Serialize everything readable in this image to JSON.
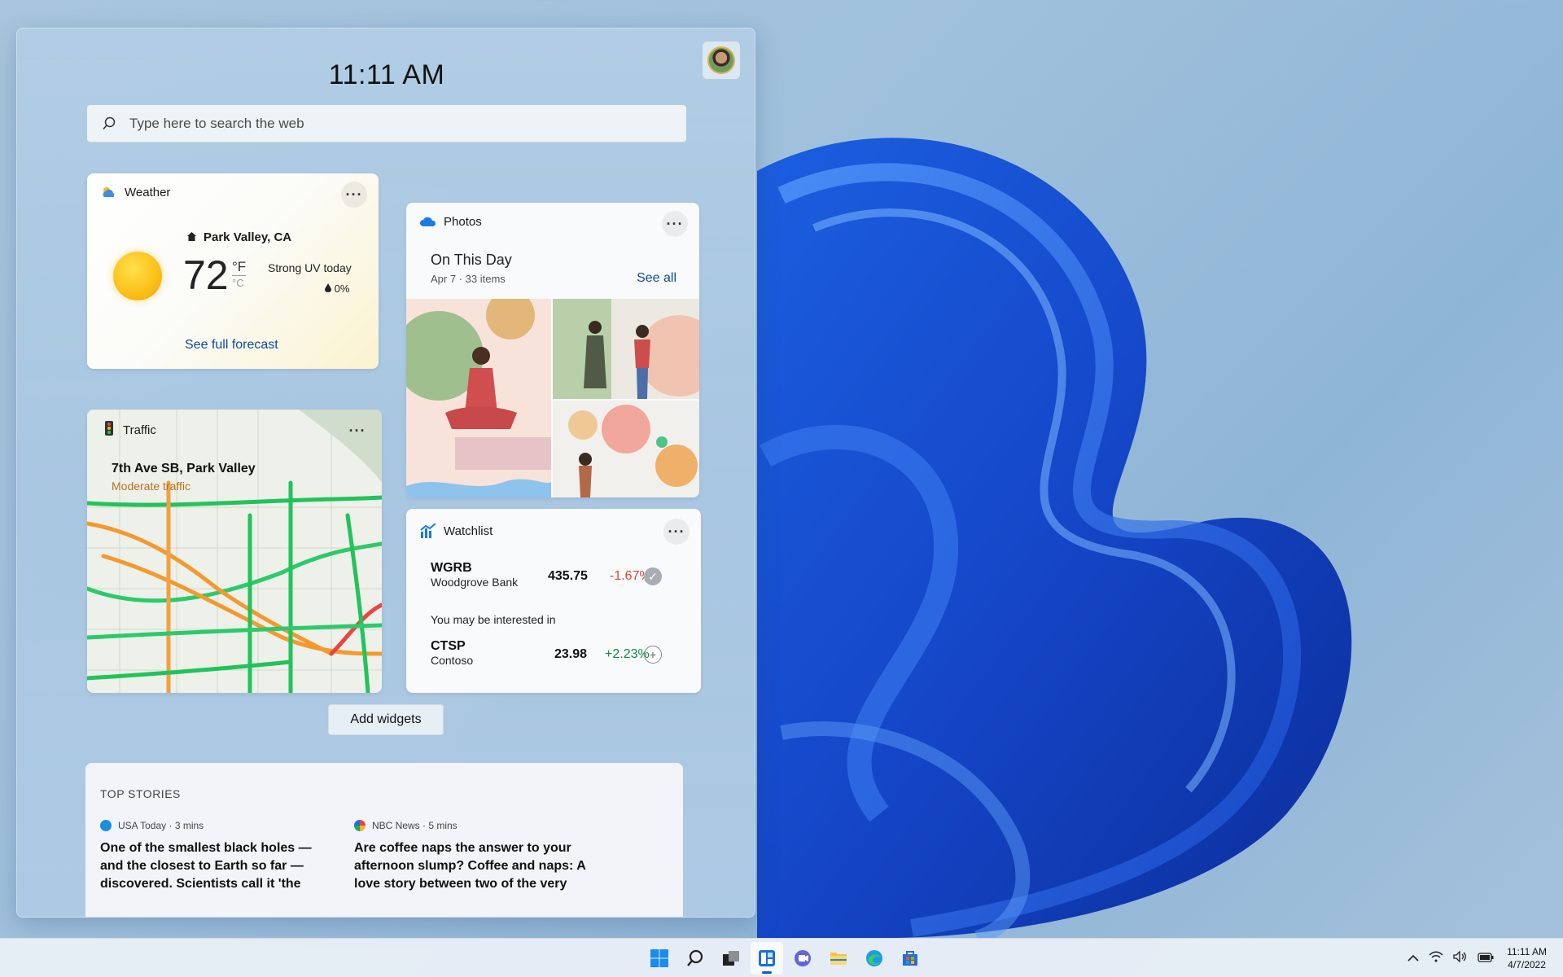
{
  "panel": {
    "time": "11:11 AM",
    "search_placeholder": "Type here to search the web",
    "add_widgets_label": "Add widgets"
  },
  "weather": {
    "title": "Weather",
    "location": "Park Valley, CA",
    "temperature": "72",
    "unit_f": "°F",
    "unit_c": "°C",
    "condition": "Strong UV today",
    "precipitation": "0%",
    "forecast_link": "See full forecast",
    "icon": "sun-icon"
  },
  "traffic": {
    "title": "Traffic",
    "route": "7th Ave SB, Park Valley",
    "status": "Moderate traffic",
    "status_color": "#b5731f"
  },
  "photos": {
    "title": "Photos",
    "album": "On This Day",
    "date": "Apr 7",
    "count": "· 33 items",
    "see_all": "See all"
  },
  "watchlist": {
    "title": "Watchlist",
    "stocks": [
      {
        "symbol": "WGRB",
        "name": "Woodgrove Bank",
        "price": "435.75",
        "change": "-1.67%",
        "color": "#e0442f"
      }
    ],
    "interest_label": "You may be interested in",
    "suggestions": [
      {
        "symbol": "CTSP",
        "name": "Contoso",
        "price": "23.98",
        "change": "+2.23%",
        "color": "#0f8a3c"
      }
    ]
  },
  "top_stories": {
    "heading": "TOP STORIES",
    "stories": [
      {
        "source": "USA Today · 3 mins",
        "title": "One of the smallest black holes — and the closest to Earth so far — discovered. Scientists call it 'the"
      },
      {
        "source": "NBC News · 5 mins",
        "title": "Are coffee naps the answer to your afternoon slump? Coffee and naps: A love story between two of the very"
      }
    ]
  },
  "taskbar": {
    "apps": [
      "start-icon",
      "search-icon",
      "task-view-icon",
      "widgets-icon",
      "chat-icon",
      "file-explorer-icon",
      "edge-icon",
      "store-icon"
    ],
    "time": "11:11 AM",
    "date": "4/7/2022"
  }
}
